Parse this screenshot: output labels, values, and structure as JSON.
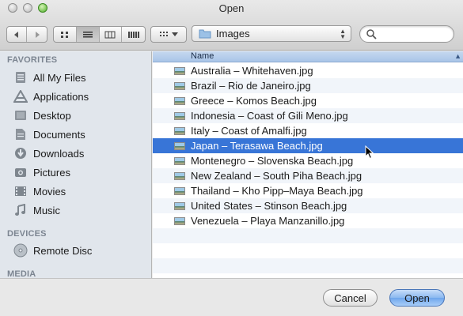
{
  "window": {
    "title": "Open"
  },
  "toolbar": {
    "location": "Images",
    "search_placeholder": ""
  },
  "sidebar": {
    "favorites_heading": "FAVORITES",
    "favorites": [
      {
        "label": "All My Files",
        "icon": "all-files-icon"
      },
      {
        "label": "Applications",
        "icon": "applications-icon"
      },
      {
        "label": "Desktop",
        "icon": "desktop-icon"
      },
      {
        "label": "Documents",
        "icon": "documents-icon"
      },
      {
        "label": "Downloads",
        "icon": "downloads-icon"
      },
      {
        "label": "Pictures",
        "icon": "pictures-icon"
      },
      {
        "label": "Movies",
        "icon": "movies-icon"
      },
      {
        "label": "Music",
        "icon": "music-icon"
      }
    ],
    "devices_heading": "DEVICES",
    "devices": [
      {
        "label": "Remote Disc",
        "icon": "disc-icon"
      }
    ],
    "media_heading": "MEDIA"
  },
  "filelist": {
    "column_name": "Name",
    "files": [
      "Australia – Whitehaven.jpg",
      "Brazil – Rio de Janeiro.jpg",
      "Greece – Komos Beach.jpg",
      "Indonesia – Coast of Gili Meno.jpg",
      "Italy – Coast of Amalfi.jpg",
      "Japan – Terasawa Beach.jpg",
      "Montenegro – Slovenska Beach.jpg",
      "New Zealand – South Piha Beach.jpg",
      "Thailand – Kho Pipp–Maya Beach.jpg",
      "United States – Stinson Beach.jpg",
      "Venezuela – Playa Manzanillo.jpg"
    ],
    "selected_index": 5
  },
  "buttons": {
    "cancel": "Cancel",
    "open": "Open"
  },
  "colors": {
    "selection": "#3875d7",
    "sidebar": "#e1e6ec",
    "header": "#a9c5e8"
  }
}
